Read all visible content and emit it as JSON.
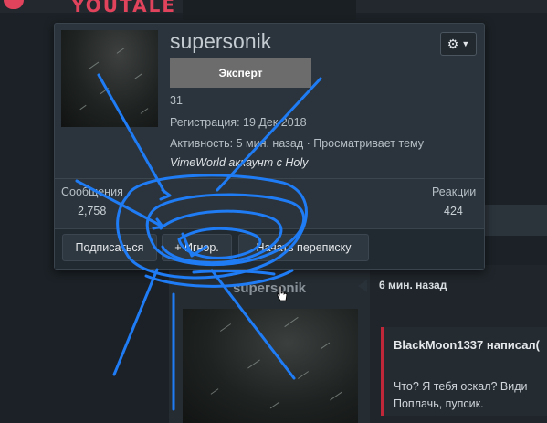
{
  "site": {
    "logo_text": "YOUTALE"
  },
  "card": {
    "username": "supersonik",
    "rank": "Эксперт",
    "message_count_line": "31",
    "registration": "Регистрация: 19 Дек 2018",
    "activity": "Активность: 5 мин. назад · Просматривает тему",
    "account": "VimeWorld аккаунт c Holy",
    "stats": {
      "messages_label": "Сообщения",
      "messages_value": "2,758",
      "reactions_label": "Реакции",
      "reactions_value": "424"
    },
    "buttons": {
      "follow": "Подписаться",
      "ignore": "+ Игнор.",
      "conversation": "Начать переписку"
    }
  },
  "post": {
    "username": "supersonik",
    "time": "6 мин. назад",
    "quote_author": "BlackMoon1337 написал(",
    "quote_text": "Что? Я тебя оскал? Види\nПоплачь, пупсик."
  },
  "colors": {
    "accent": "#e2435c",
    "quote_border": "#c0283a",
    "scribble": "#1f7cf5"
  },
  "icons": [
    "gear-icon",
    "chevron-down-icon",
    "cursor-icon"
  ]
}
